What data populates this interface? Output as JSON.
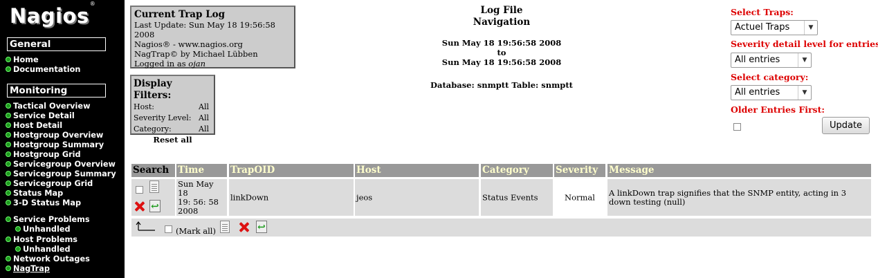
{
  "sidebar": {
    "logo": "Nagios",
    "logo_mark": "®",
    "general": {
      "heading": "General",
      "items": [
        "Home",
        "Documentation"
      ]
    },
    "monitoring": {
      "heading": "Monitoring",
      "items": [
        "Tactical Overview",
        "Service Detail",
        "Host Detail",
        "Hostgroup Overview",
        "Hostgroup Summary",
        "Hostgroup Grid",
        "Servicegroup Overview",
        "Servicegroup Summary",
        "Servicegroup Grid",
        "Status Map",
        "3-D Status Map"
      ]
    },
    "problems": {
      "service_problems": "Service Problems",
      "service_unhandled": "Unhandled",
      "host_problems": "Host Problems",
      "host_unhandled": "Unhandled",
      "network_outages": "Network Outages",
      "nagtrap": "NagTrap"
    }
  },
  "trap_log": {
    "title": "Current Trap Log",
    "last_update": "Last Update: Sun May 18 19:56:58 2008",
    "nagios": "Nagios® - www.nagios.org",
    "nagtrap": "NagTrap© by Michael Lübben",
    "logged_in_prefix": "Logged in as ",
    "user": "ojan"
  },
  "filters": {
    "title": "Display Filters:",
    "host_label": "Host:",
    "host_value": "All",
    "severity_label": "Severity Level:",
    "severity_value": "All",
    "category_label": "Category:",
    "category_value": "All",
    "reset": "Reset all"
  },
  "log_nav": {
    "title1": "Log File",
    "title2": "Navigation",
    "from": "Sun May 18 19:56:58 2008",
    "to_word": "to",
    "to": "Sun May 18 19:56:58 2008",
    "database": "Database: snmptt Table: snmptt"
  },
  "form": {
    "select_traps_label": "Select Traps:",
    "select_traps_value": "Actuel Traps",
    "severity_label": "Severity detail level for entries:",
    "severity_value": "All entries",
    "category_label": "Select category:",
    "category_value": "All entries",
    "older_label": "Older Entries First:",
    "update_button": "Update"
  },
  "table": {
    "headers": [
      "Search",
      "Time",
      "TrapOID",
      "Host",
      "Category",
      "Severity",
      "Message"
    ],
    "rows": [
      {
        "time_l1": "Sun May 18",
        "time_l2": "19: 56: 58",
        "time_l3": "2008",
        "trapoid": "linkDown",
        "host": "jeos",
        "category": "Status Events",
        "severity": "Normal",
        "message": "A linkDown trap signifies that the SNMP entity, acting in 3 down testing (null)"
      }
    ],
    "mark_all": "(Mark all)"
  },
  "colors": {
    "sidebar_bg": "#000000",
    "status_dot": "#1f9a1f",
    "form_label": "#dd0000",
    "header_bg": "#999999",
    "header_text": "#ffffcc",
    "row_bg": "#dcdcdc"
  },
  "icons": [
    "status-dot-icon",
    "document-icon",
    "delete-x-icon",
    "acknowledge-icon",
    "return-arrow-icon",
    "dropdown-arrow-icon"
  ]
}
